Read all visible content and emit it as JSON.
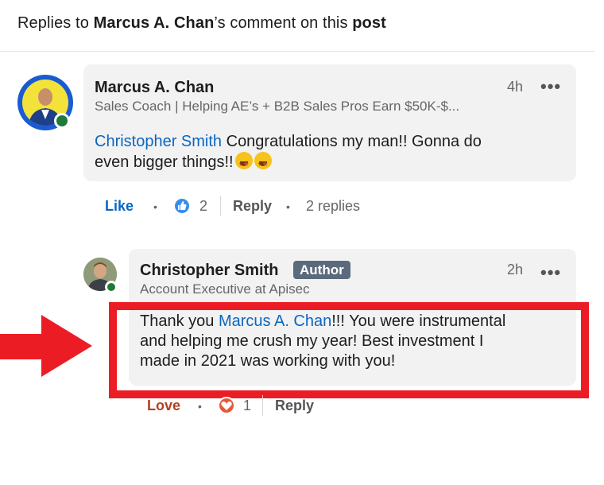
{
  "header": {
    "prefix": "Replies to ",
    "author": "Marcus A. Chan",
    "middle": "’s comment on this ",
    "post": "post"
  },
  "comment": {
    "author": "Marcus A. Chan",
    "headline": "Sales Coach | Helping AE’s + B2B Sales Pros Earn $50K-$...",
    "time": "4h",
    "mention": "Christopher Smith",
    "text_line1": " Congratulations my man!! Gonna do",
    "text_line2": "even bigger things!!",
    "emoji": "star-struck-emoji",
    "actions": {
      "like_label": "Like",
      "reaction_count": "2",
      "reply_label": "Reply",
      "replies_count": "2 replies"
    }
  },
  "reply": {
    "author": "Christopher Smith",
    "badge": "Author",
    "headline": "Account Executive at Apisec",
    "time": "2h",
    "text_prefix": "Thank you ",
    "mention": "Marcus A. Chan",
    "text_line1_rest": "!!! You were instrumental",
    "text_line2": "and helping me crush my year!  Best investment I",
    "text_line3": "made in 2021 was working with you!",
    "actions": {
      "love_label": "Love",
      "reaction_count": "1",
      "reply_label": "Reply"
    }
  },
  "colors": {
    "link_blue": "#0a66c2",
    "highlight_red": "#ec1c24",
    "presence_green": "#1f7a3a"
  }
}
